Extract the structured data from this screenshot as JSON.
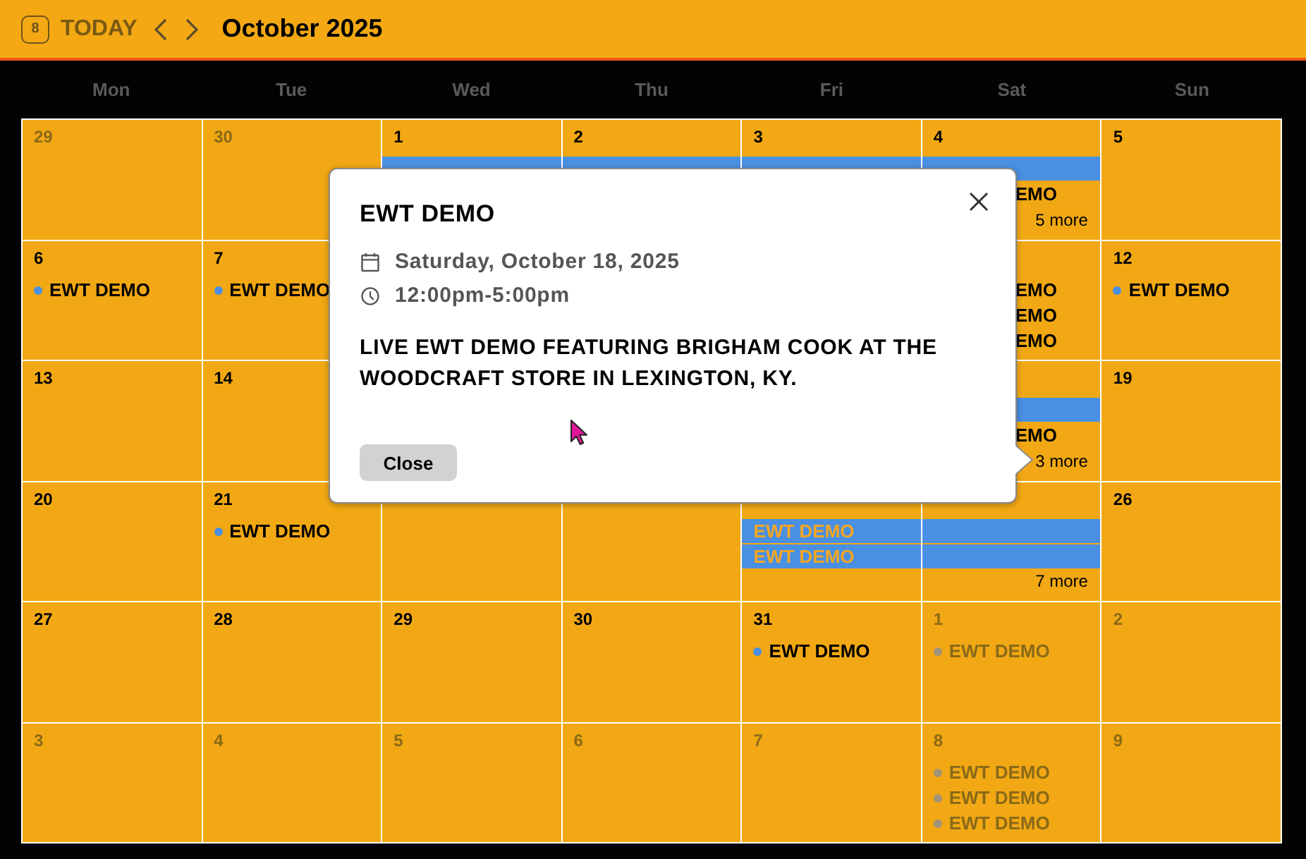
{
  "header": {
    "today_badge": "8",
    "today_label": "TODAY",
    "title": "October 2025"
  },
  "weekdays": [
    "Mon",
    "Tue",
    "Wed",
    "Thu",
    "Fri",
    "Sat",
    "Sun"
  ],
  "weeks": [
    {
      "days": [
        {
          "number": "29",
          "other_month": true
        },
        {
          "number": "30",
          "other_month": true
        },
        {
          "number": "1",
          "other_month": false,
          "events": [
            {
              "kind": "bar"
            }
          ]
        },
        {
          "number": "2",
          "other_month": false,
          "events": [
            {
              "kind": "bar"
            }
          ]
        },
        {
          "number": "3",
          "other_month": false,
          "events": [
            {
              "kind": "bar"
            }
          ]
        },
        {
          "number": "4",
          "other_month": false,
          "events": [
            {
              "kind": "bar"
            },
            {
              "kind": "fragment",
              "label": "EMO"
            }
          ],
          "more": "5 more"
        },
        {
          "number": "5",
          "other_month": false
        }
      ]
    },
    {
      "days": [
        {
          "number": "6",
          "other_month": false,
          "events": [
            {
              "kind": "dot",
              "label": "EWT DEMO"
            }
          ]
        },
        {
          "number": "7",
          "other_month": false,
          "events": [
            {
              "kind": "dot",
              "label": "EWT DEMO"
            }
          ]
        }
      ],
      "end_days": [
        {
          "other_month": false,
          "events": [
            {
              "kind": "fragment",
              "label": "EMO"
            },
            {
              "kind": "fragment",
              "label": "EMO"
            },
            {
              "kind": "fragment",
              "label": "EMO"
            }
          ]
        },
        {
          "number": "12",
          "other_month": false,
          "events": [
            {
              "kind": "dot",
              "label": "EWT DEMO"
            }
          ]
        }
      ]
    },
    {
      "days": [
        {
          "number": "13",
          "other_month": false
        },
        {
          "number": "14",
          "other_month": false
        }
      ],
      "end_days": [
        {
          "other_month": false,
          "events": [
            {
              "kind": "bar"
            },
            {
              "kind": "fragment",
              "label": "EMO"
            }
          ],
          "more": "3 more"
        },
        {
          "number": "19",
          "other_month": false
        }
      ]
    },
    {
      "days": [
        {
          "number": "20",
          "other_month": false
        },
        {
          "number": "21",
          "other_month": false,
          "events": [
            {
              "kind": "dot",
              "label": "EWT DEMO"
            }
          ]
        }
      ],
      "end_days": [
        {
          "other_month": false,
          "events": [
            {
              "kind": "bar",
              "label": "EWT DEMO"
            },
            {
              "kind": "bar",
              "label": "EWT DEMO"
            }
          ]
        },
        {
          "other_month": false,
          "events": [
            {
              "kind": "bar"
            },
            {
              "kind": "bar"
            }
          ],
          "more": "7 more"
        },
        {
          "number": "26",
          "other_month": false
        }
      ]
    },
    {
      "days": [
        {
          "number": "27",
          "other_month": false
        },
        {
          "number": "28",
          "other_month": false
        },
        {
          "number": "29",
          "other_month": false
        },
        {
          "number": "30",
          "other_month": false
        },
        {
          "number": "31",
          "other_month": false,
          "events": [
            {
              "kind": "dot",
              "label": "EWT DEMO"
            }
          ]
        },
        {
          "number": "1",
          "other_month": true,
          "events": [
            {
              "kind": "dot",
              "label": "EWT DEMO"
            }
          ]
        },
        {
          "number": "2",
          "other_month": true
        }
      ]
    },
    {
      "days": [
        {
          "number": "3",
          "other_month": true
        },
        {
          "number": "4",
          "other_month": true
        },
        {
          "number": "5",
          "other_month": true
        },
        {
          "number": "6",
          "other_month": true
        },
        {
          "number": "7",
          "other_month": true
        },
        {
          "number": "8",
          "other_month": true,
          "events": [
            {
              "kind": "dot",
              "label": "EWT DEMO"
            },
            {
              "kind": "dot",
              "label": "EWT DEMO"
            },
            {
              "kind": "dot",
              "label": "EWT DEMO"
            }
          ]
        },
        {
          "number": "9",
          "other_month": true
        }
      ]
    }
  ],
  "popup": {
    "title": "EWT DEMO",
    "date": "Saturday, October 18, 2025",
    "time": "12:00pm-5:00pm",
    "description": "LIVE EWT DEMO FEATURING BRIGHAM COOK AT THE WOODCRAFT STORE IN LEXINGTON, KY.",
    "close_button": "Close"
  }
}
